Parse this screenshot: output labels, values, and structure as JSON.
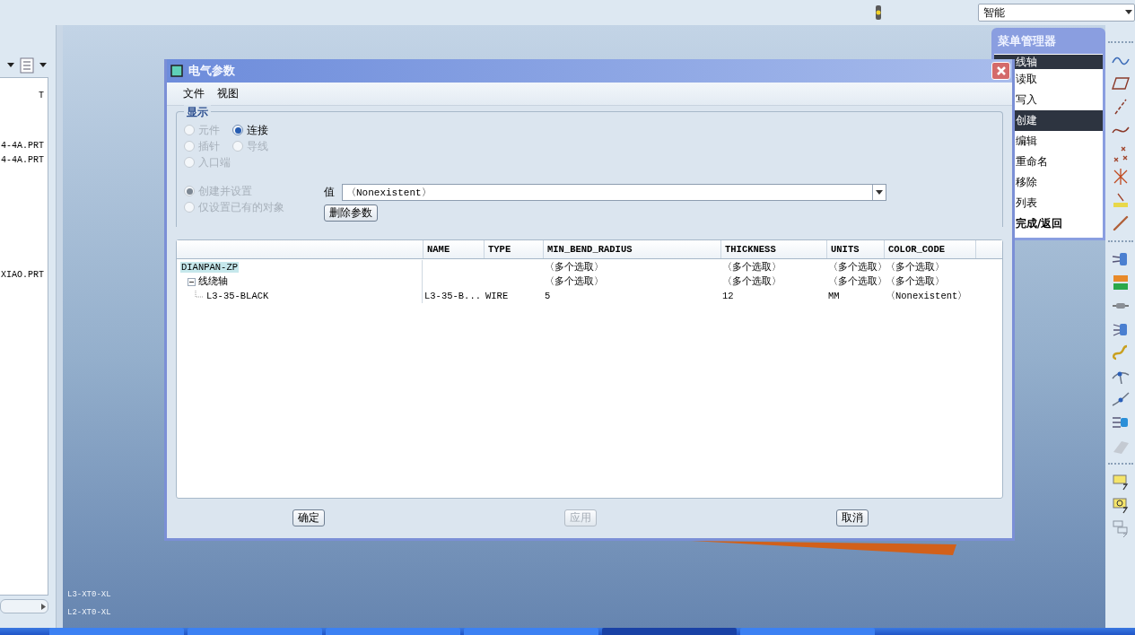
{
  "top_bar": {
    "filter_select": "智能"
  },
  "model_tree": {
    "items": [
      "T",
      "4-4A.PRT",
      "4-4A.PRT",
      "XIAO.PRT"
    ]
  },
  "canvas": {
    "status_lines": [
      "L3-XT0-XL",
      "L2-XT0-XL"
    ]
  },
  "menu_manager": {
    "title": "菜单管理器",
    "items": [
      {
        "label": "线轴",
        "selected": true,
        "kind": "header"
      },
      {
        "label": "读取",
        "selected": false,
        "kind": "item"
      },
      {
        "label": "写入",
        "selected": false,
        "kind": "item"
      },
      {
        "label": "创建",
        "selected": true,
        "kind": "item"
      },
      {
        "label": "编辑",
        "selected": false,
        "kind": "item"
      },
      {
        "label": "重命名",
        "selected": false,
        "kind": "item"
      },
      {
        "label": "移除",
        "selected": false,
        "kind": "item"
      },
      {
        "label": "列表",
        "selected": false,
        "kind": "item"
      },
      {
        "label": "完成/返回",
        "selected": false,
        "kind": "action"
      }
    ]
  },
  "dialog": {
    "title": "电气参数",
    "menus": [
      "文件",
      "视图"
    ],
    "display_group": {
      "title": "显示",
      "options": [
        {
          "label": "元件",
          "selected": false,
          "disabled": true
        },
        {
          "label": "连接",
          "selected": true,
          "disabled": false
        },
        {
          "label": "插针",
          "selected": false,
          "disabled": true
        },
        {
          "label": "导线",
          "selected": false,
          "disabled": true
        },
        {
          "label": "入口端",
          "selected": false,
          "disabled": true
        }
      ]
    },
    "mode_options": [
      {
        "label": "创建并设置",
        "selected": true,
        "disabled": true
      },
      {
        "label": "仅设置已有的对象",
        "selected": false,
        "disabled": true
      }
    ],
    "value_label": "值",
    "value": "〈Nonexistent〉",
    "delete_button": "删除参数",
    "table": {
      "columns": [
        "NAME",
        "TYPE",
        "MIN_BEND_RADIUS",
        "THICKNESS",
        "UNITS",
        "COLOR_CODE"
      ],
      "rows": [
        {
          "name": "DIANPAN-ZP",
          "selected": true,
          "cells": [
            null,
            null,
            "〈多个选取〉",
            "〈多个选取〉",
            "〈多个选取〉",
            "〈多个选取〉"
          ],
          "children": [
            {
              "name": "线绕轴",
              "selected": false,
              "expanded": true,
              "cells": [
                null,
                null,
                "〈多个选取〉",
                "〈多个选取〉",
                "〈多个选取〉",
                "〈多个选取〉"
              ],
              "children": [
                {
                  "name": "L3-35-BLACK",
                  "selected": false,
                  "cells": [
                    "L3-35-B...",
                    "WIRE",
                    "5",
                    "12",
                    "MM",
                    "〈Nonexistent〉"
                  ]
                }
              ]
            }
          ]
        }
      ]
    },
    "buttons": [
      {
        "label": "确定",
        "disabled": false
      },
      {
        "label": "应用",
        "disabled": true
      },
      {
        "label": "取消",
        "disabled": false
      }
    ]
  }
}
